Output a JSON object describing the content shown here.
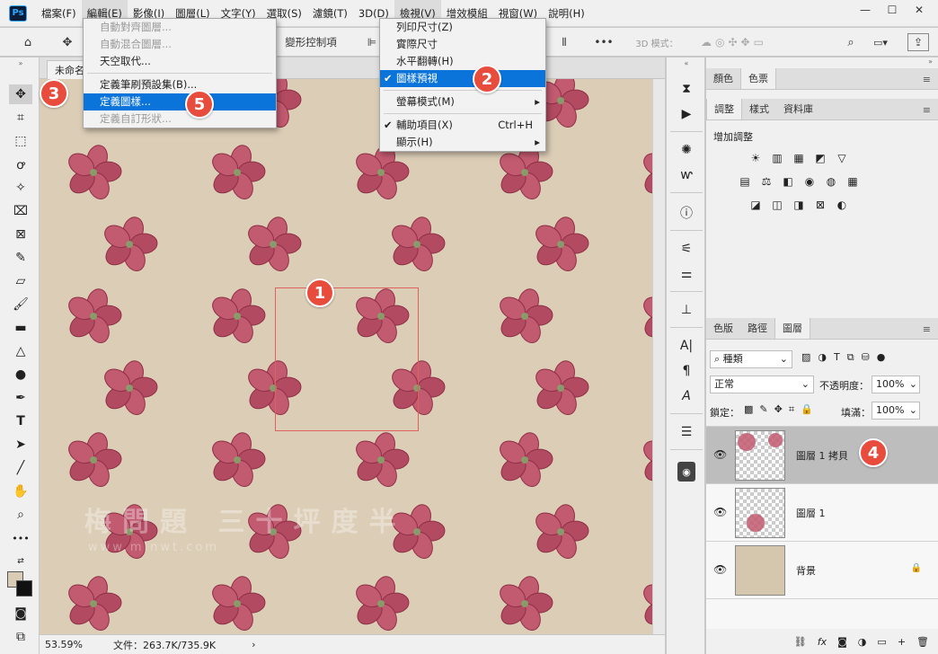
{
  "menubar": {
    "logo": "Ps",
    "items": [
      "檔案(F)",
      "編輯(E)",
      "影像(I)",
      "圖層(L)",
      "文字(Y)",
      "選取(S)",
      "濾鏡(T)",
      "3D(D)",
      "檢視(V)",
      "增效模組",
      "視窗(W)",
      "說明(H)"
    ],
    "window_min": "—",
    "window_max": "☐",
    "window_close": "✕"
  },
  "optionsbar": {
    "home_icon": "⌂",
    "move_icon": "✥",
    "transform_label": "變形控制項",
    "more": "•••",
    "mode3d": "3D 模式：",
    "search_icon": "⌕"
  },
  "document": {
    "tab_label": "未命名"
  },
  "edit_menu": {
    "items": [
      {
        "label": "自動對齊圖層...",
        "state": "disabled"
      },
      {
        "label": "自動混合圖層...",
        "state": "disabled"
      },
      {
        "label": "天空取代...",
        "state": "normal"
      },
      {
        "sep": true
      },
      {
        "label": "定義筆刷預設集(B)...",
        "state": "normal"
      },
      {
        "label": "定義圖樣...",
        "state": "selected"
      },
      {
        "label": "定義自訂形狀...",
        "state": "disabled"
      }
    ]
  },
  "view_menu": {
    "items": [
      {
        "label": "列印尺寸(Z)",
        "state": "normal"
      },
      {
        "label": "實際尺寸",
        "state": "normal"
      },
      {
        "label": "水平翻轉(H)",
        "state": "normal"
      },
      {
        "label": "圖樣預視",
        "state": "selected",
        "check": "✔"
      },
      {
        "sep": true
      },
      {
        "label": "螢幕模式(M)",
        "state": "normal",
        "arrow": "▸"
      },
      {
        "sep": true
      },
      {
        "label": "輔助項目(X)",
        "state": "normal",
        "check": "✔",
        "shortcut": "Ctrl+H"
      },
      {
        "label": "顯示(H)",
        "state": "normal",
        "arrow": "▸"
      }
    ]
  },
  "watermark": {
    "line1": "梅問題 三十坪度半",
    "line2": "www.minwt.com"
  },
  "status": {
    "zoom": "53.59%",
    "file": "文件：263.7K/735.9K",
    "arrow": "›"
  },
  "panels": {
    "color_tabs": [
      "顏色",
      "色票"
    ],
    "adjust_tabs": [
      "調整",
      "樣式",
      "資料庫"
    ],
    "add_adjust": "增加調整",
    "adj_row1": [
      "☀",
      "▥",
      "▦",
      "◩",
      "▽"
    ],
    "adj_row2": [
      "▤",
      "⚖",
      "◧",
      "◉",
      "◍",
      "▦"
    ],
    "adj_row3": [
      "◪",
      "◫",
      "◨",
      "⊠",
      "◐"
    ],
    "layer_tabs": [
      "色版",
      "路徑",
      "圖層"
    ],
    "filter_kind": "種類",
    "blend_mode": "正常",
    "opacity_label": "不透明度：",
    "opacity_value": "100%",
    "lock_label": "鎖定：",
    "fill_label": "填滿：",
    "fill_value": "100%",
    "layers": [
      {
        "name": "圖層 1 拷貝",
        "selected": true
      },
      {
        "name": "圖層 1",
        "selected": false
      },
      {
        "name": "背景",
        "selected": false,
        "locked": "🔒"
      }
    ],
    "bottom_icons": [
      "⛓",
      "fx",
      "◙",
      "◑",
      "▭",
      "+",
      "🗑"
    ]
  },
  "badges": [
    "1",
    "2",
    "3",
    "4",
    "5"
  ],
  "colors": {
    "canvas_bg": "#dccdb6",
    "menu_highlight": "#0a74da",
    "badge": "#e84c3d",
    "flower": "#c25a70"
  }
}
